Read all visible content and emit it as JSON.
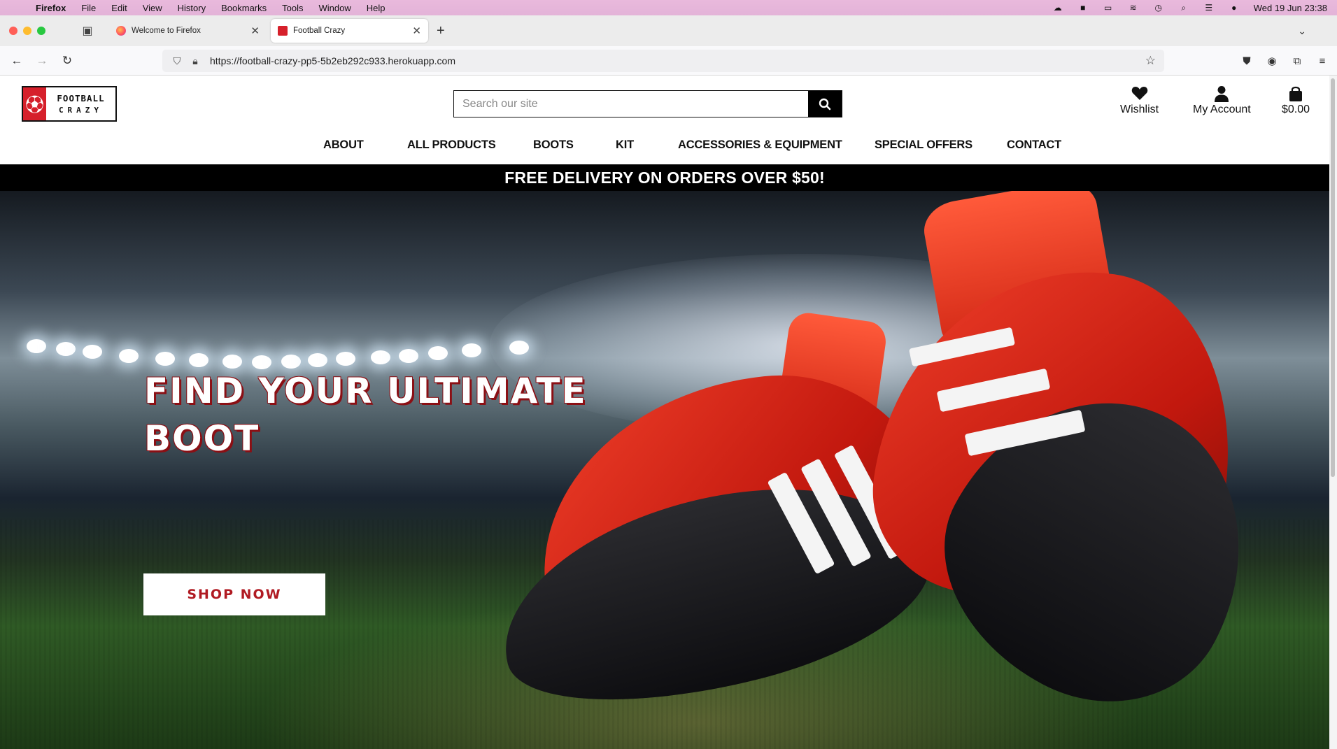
{
  "menubar": {
    "app": "Firefox",
    "items": [
      "File",
      "Edit",
      "View",
      "History",
      "Bookmarks",
      "Tools",
      "Window",
      "Help"
    ],
    "clock": "Wed 19 Jun  23:38"
  },
  "tabs": [
    {
      "label": "Welcome to Firefox"
    },
    {
      "label": "Football Crazy"
    }
  ],
  "navbar": {
    "url": "https://football-crazy-pp5-5b2eb292c933.herokuapp.com"
  },
  "site": {
    "logo": {
      "line1": "FOOTBALL",
      "line2": "CRAZY"
    },
    "search": {
      "placeholder": "Search our site"
    },
    "header_icons": {
      "wishlist": "Wishlist",
      "account": "My Account",
      "cart_total": "$0.00"
    },
    "nav": [
      "ABOUT",
      "ALL PRODUCTS",
      "BOOTS",
      "KIT",
      "ACCESSORIES & EQUIPMENT",
      "SPECIAL OFFERS",
      "CONTACT"
    ],
    "promo_banner": "FREE DELIVERY ON ORDERS OVER $50!",
    "hero": {
      "title_line1": "FIND YOUR ULTIMATE",
      "title_line2": "BOOT",
      "cta": "SHOP NOW"
    }
  },
  "colors": {
    "brand_red": "#d6202b",
    "cta_text": "#b01a22",
    "promo_bg": "#000000"
  }
}
